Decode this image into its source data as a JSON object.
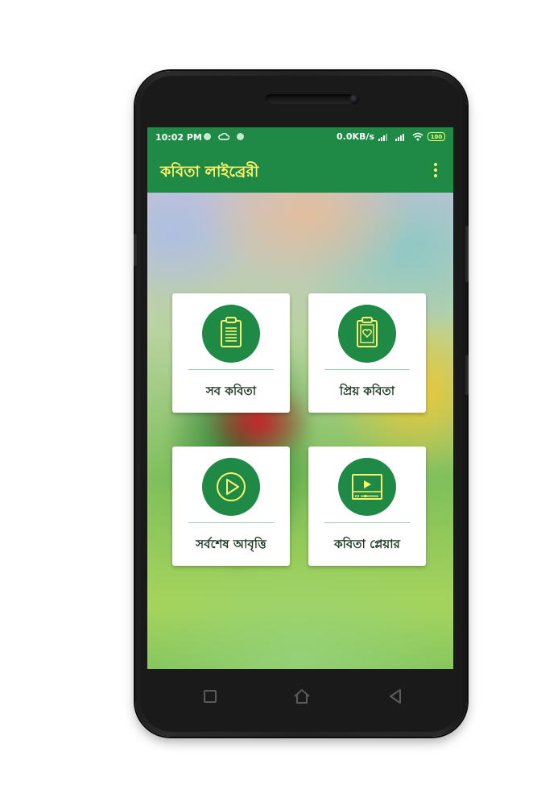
{
  "status_bar": {
    "time": "10:02 PM",
    "network_speed": "0.0KB/s",
    "battery": "100"
  },
  "app_bar": {
    "title": "কবিতা লাইব্রেরী",
    "menu_icon": "more-vert-icon"
  },
  "menu_cards": [
    {
      "label": "সব কবিতা",
      "icon": "clipboard-list-icon"
    },
    {
      "label": "প্রিয় কবিতা",
      "icon": "clipboard-heart-icon"
    },
    {
      "label": "সর্বশেষ আবৃত্তি",
      "icon": "play-circle-icon"
    },
    {
      "label": "কবিতা প্লেয়ার",
      "icon": "video-player-icon"
    }
  ],
  "nav_bar": {
    "recent": "square-icon",
    "home": "home-icon",
    "back": "back-triangle-icon"
  },
  "colors": {
    "primary": "#1f8a45",
    "title_yellow": "#fff36b",
    "card_bg": "#ffffff"
  }
}
